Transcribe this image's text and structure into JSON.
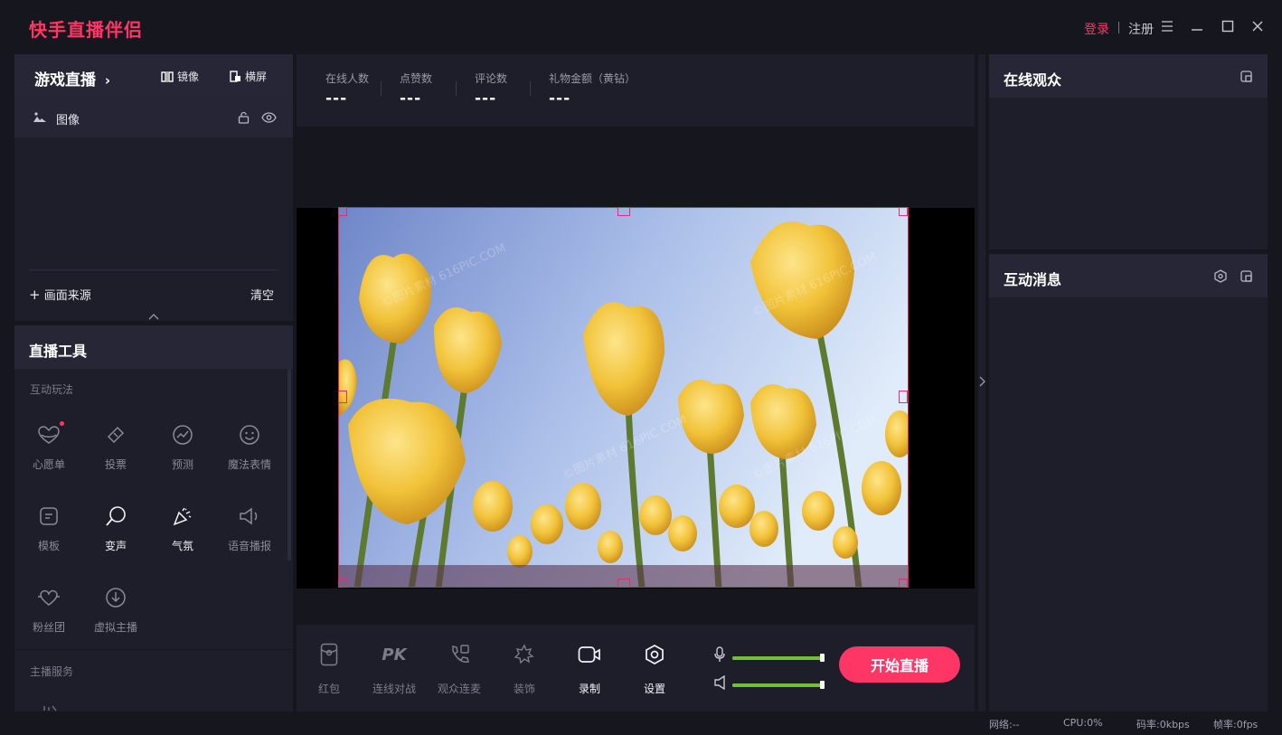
{
  "app": {
    "title": "快手直播伴侣",
    "login": "登录",
    "register": "注册"
  },
  "left_panel": {
    "live_type": "游戏直播",
    "mirror_label": "镜像",
    "landscape_label": "横屏",
    "sources": [
      {
        "name": "图像",
        "icon": "image-icon"
      }
    ],
    "add_source_label": "画面来源",
    "clear_label": "清空"
  },
  "tools": {
    "title": "直播工具",
    "section_interactive": "互动玩法",
    "items": [
      {
        "label": "心愿单",
        "icon": "wishlist-icon",
        "badge": true,
        "active": false
      },
      {
        "label": "投票",
        "icon": "vote-icon",
        "active": false
      },
      {
        "label": "预测",
        "icon": "predict-icon",
        "active": false
      },
      {
        "label": "魔法表情",
        "icon": "smiley-icon",
        "active": false
      },
      {
        "label": "模板",
        "icon": "template-icon",
        "active": false
      },
      {
        "label": "变声",
        "icon": "voice-change-icon",
        "active": true
      },
      {
        "label": "气氛",
        "icon": "party-icon",
        "active": true
      },
      {
        "label": "语音播报",
        "icon": "speaker-icon",
        "active": false
      },
      {
        "label": "粉丝团",
        "icon": "fan-heart-icon",
        "active": false
      },
      {
        "label": "虚拟主播",
        "icon": "virtual-anchor-icon",
        "active": false
      }
    ],
    "section_anchor": "主播服务"
  },
  "stats": [
    {
      "label": "在线人数",
      "value": "---"
    },
    {
      "label": "点赞数",
      "value": "---"
    },
    {
      "label": "评论数",
      "value": "---"
    },
    {
      "label": "礼物金额（黄钻）",
      "value": "---"
    }
  ],
  "bottom_bar": {
    "items": [
      {
        "label": "红包",
        "icon": "red-packet-icon",
        "active": false
      },
      {
        "label": "连线对战",
        "icon": "pk-icon",
        "active": false
      },
      {
        "label": "观众连麦",
        "icon": "audience-call-icon",
        "active": false
      },
      {
        "label": "装饰",
        "icon": "decoration-icon",
        "active": false
      },
      {
        "label": "录制",
        "icon": "record-icon",
        "active": true
      },
      {
        "label": "设置",
        "icon": "settings-icon",
        "active": true
      }
    ],
    "mic_volume": 1.0,
    "speaker_volume": 1.0,
    "start_label": "开始直播"
  },
  "right_panel": {
    "viewers_title": "在线观众",
    "messages_title": "互动消息"
  },
  "status": {
    "network": "网络:--",
    "cpu": "CPU:0%",
    "bitrate": "码率:0kbps",
    "fps": "帧率:0fps"
  },
  "colors": {
    "accent": "#fe3666",
    "volume": "#72c134",
    "panel": "#1e1e2b",
    "header": "#262637",
    "background": "#16161f"
  }
}
